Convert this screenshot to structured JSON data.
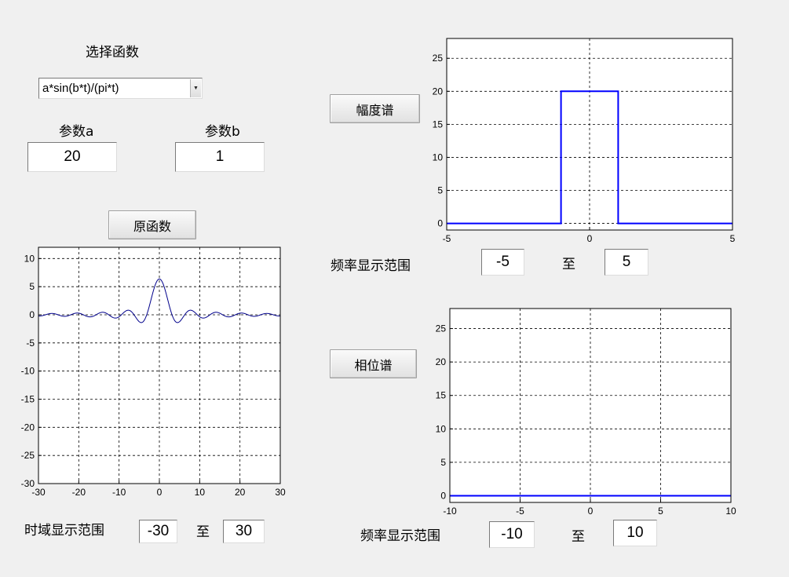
{
  "controls": {
    "select_function_label": "选择函数",
    "function_dropdown": {
      "selected": "a*sin(b*t)/(pi*t)"
    },
    "param_a_label": "参数a",
    "param_a_value": "20",
    "param_b_label": "参数b",
    "param_b_value": "1",
    "original_button": "原函数",
    "amplitude_button": "幅度谱",
    "phase_button": "相位谱"
  },
  "ranges": {
    "time_label": "时域显示范围",
    "time_from": "-30",
    "time_to": "30",
    "amp_freq_label": "频率显示范围",
    "amp_freq_from": "-5",
    "amp_freq_to": "5",
    "phase_freq_label": "频率显示范围",
    "phase_freq_from": "-10",
    "phase_freq_to": "10",
    "to_word": "至"
  },
  "colors": {
    "blue": "#0000ff",
    "grid": "#000000",
    "background": "#f0f0f0"
  },
  "chart_data": [
    {
      "id": "time",
      "type": "line",
      "function": "a*sin(b*t)/(pi*t)",
      "a": 20,
      "b": 1,
      "xlim": [
        -30,
        30
      ],
      "ylim": [
        -30,
        12
      ],
      "xticks": [
        "-30",
        "-20",
        "-10",
        "0",
        "10",
        "20",
        "30"
      ],
      "yticks": [
        "10",
        "5",
        "0",
        "-5",
        "-10",
        "-15",
        "-20",
        "-25",
        "-30"
      ],
      "line_color": "#00008b",
      "grid": true
    },
    {
      "id": "amp",
      "type": "line",
      "x": [
        -5,
        -1,
        -1,
        1,
        1,
        5
      ],
      "y": [
        0,
        0,
        20,
        20,
        0,
        0
      ],
      "xlim": [
        -5,
        5
      ],
      "ylim": [
        -1,
        28
      ],
      "xticks": [
        "-5",
        "0",
        "5"
      ],
      "yticks": [
        "25",
        "20",
        "15",
        "10",
        "5",
        "0"
      ],
      "line_color": "#0000ff",
      "grid": true
    },
    {
      "id": "phase",
      "type": "line",
      "x": [
        -10,
        10
      ],
      "y": [
        0,
        0
      ],
      "xlim": [
        -10,
        10
      ],
      "ylim": [
        -1,
        28
      ],
      "xticks": [
        "-10",
        "-5",
        "0",
        "5",
        "10"
      ],
      "yticks": [
        "25",
        "20",
        "15",
        "10",
        "5",
        "0"
      ],
      "line_color": "#0000ff",
      "grid": true
    }
  ]
}
